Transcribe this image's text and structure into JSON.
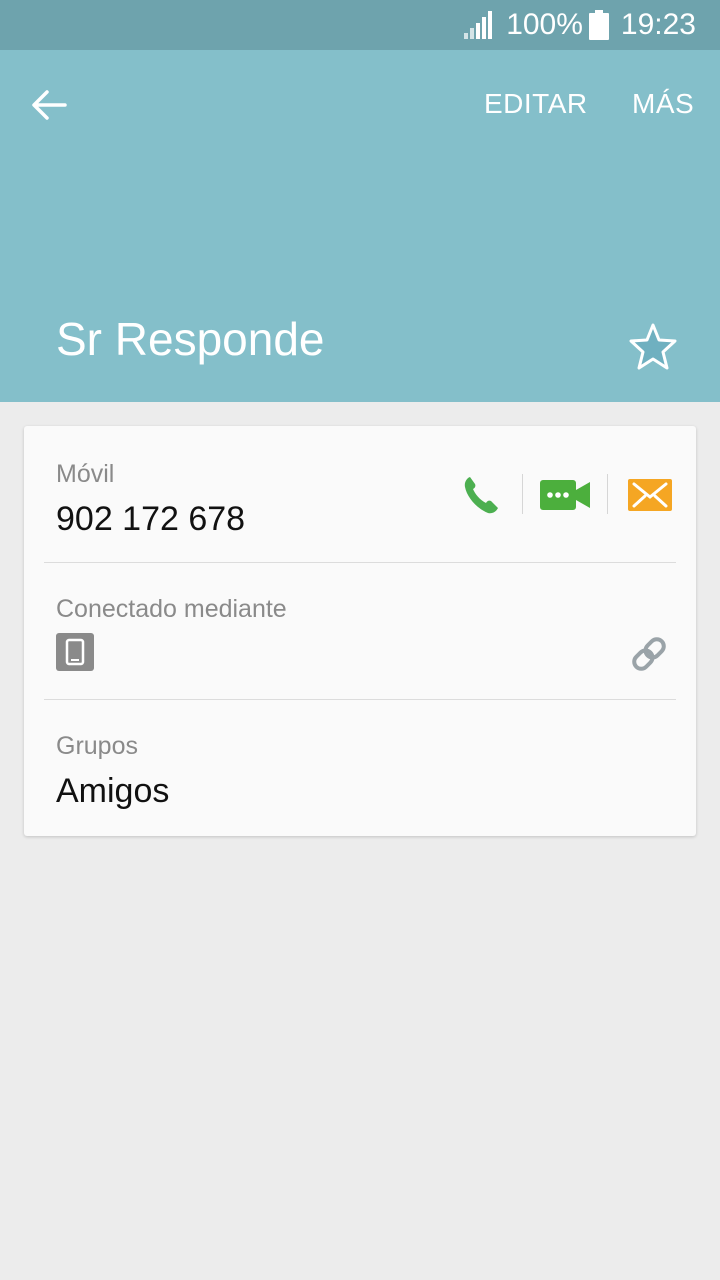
{
  "status_bar": {
    "battery": "100%",
    "time": "19:23",
    "icons": [
      "signal-icon",
      "battery-icon"
    ]
  },
  "header": {
    "back_icon": "back-arrow-icon",
    "edit_label": "EDITAR",
    "more_label": "MÁS",
    "contact_name": "Sr Responde",
    "star_icon": "star-outline-icon"
  },
  "card": {
    "phone": {
      "label": "Móvil",
      "value": "902 172 678",
      "actions": [
        "phone-call-icon",
        "video-call-icon",
        "message-icon"
      ]
    },
    "connected": {
      "label": "Conectado mediante",
      "device_icon": "device-icon",
      "link_icon": "link-icon"
    },
    "groups": {
      "label": "Grupos",
      "value": "Amigos"
    }
  },
  "colors": {
    "status_bar": "#6ea3ad",
    "header": "#84bfca",
    "background": "#ececec",
    "card": "#fafafa",
    "call_green": "#4caf50",
    "video_green": "#4caf3d",
    "message_orange": "#f5a623",
    "muted_icon": "#9aa3a8"
  }
}
